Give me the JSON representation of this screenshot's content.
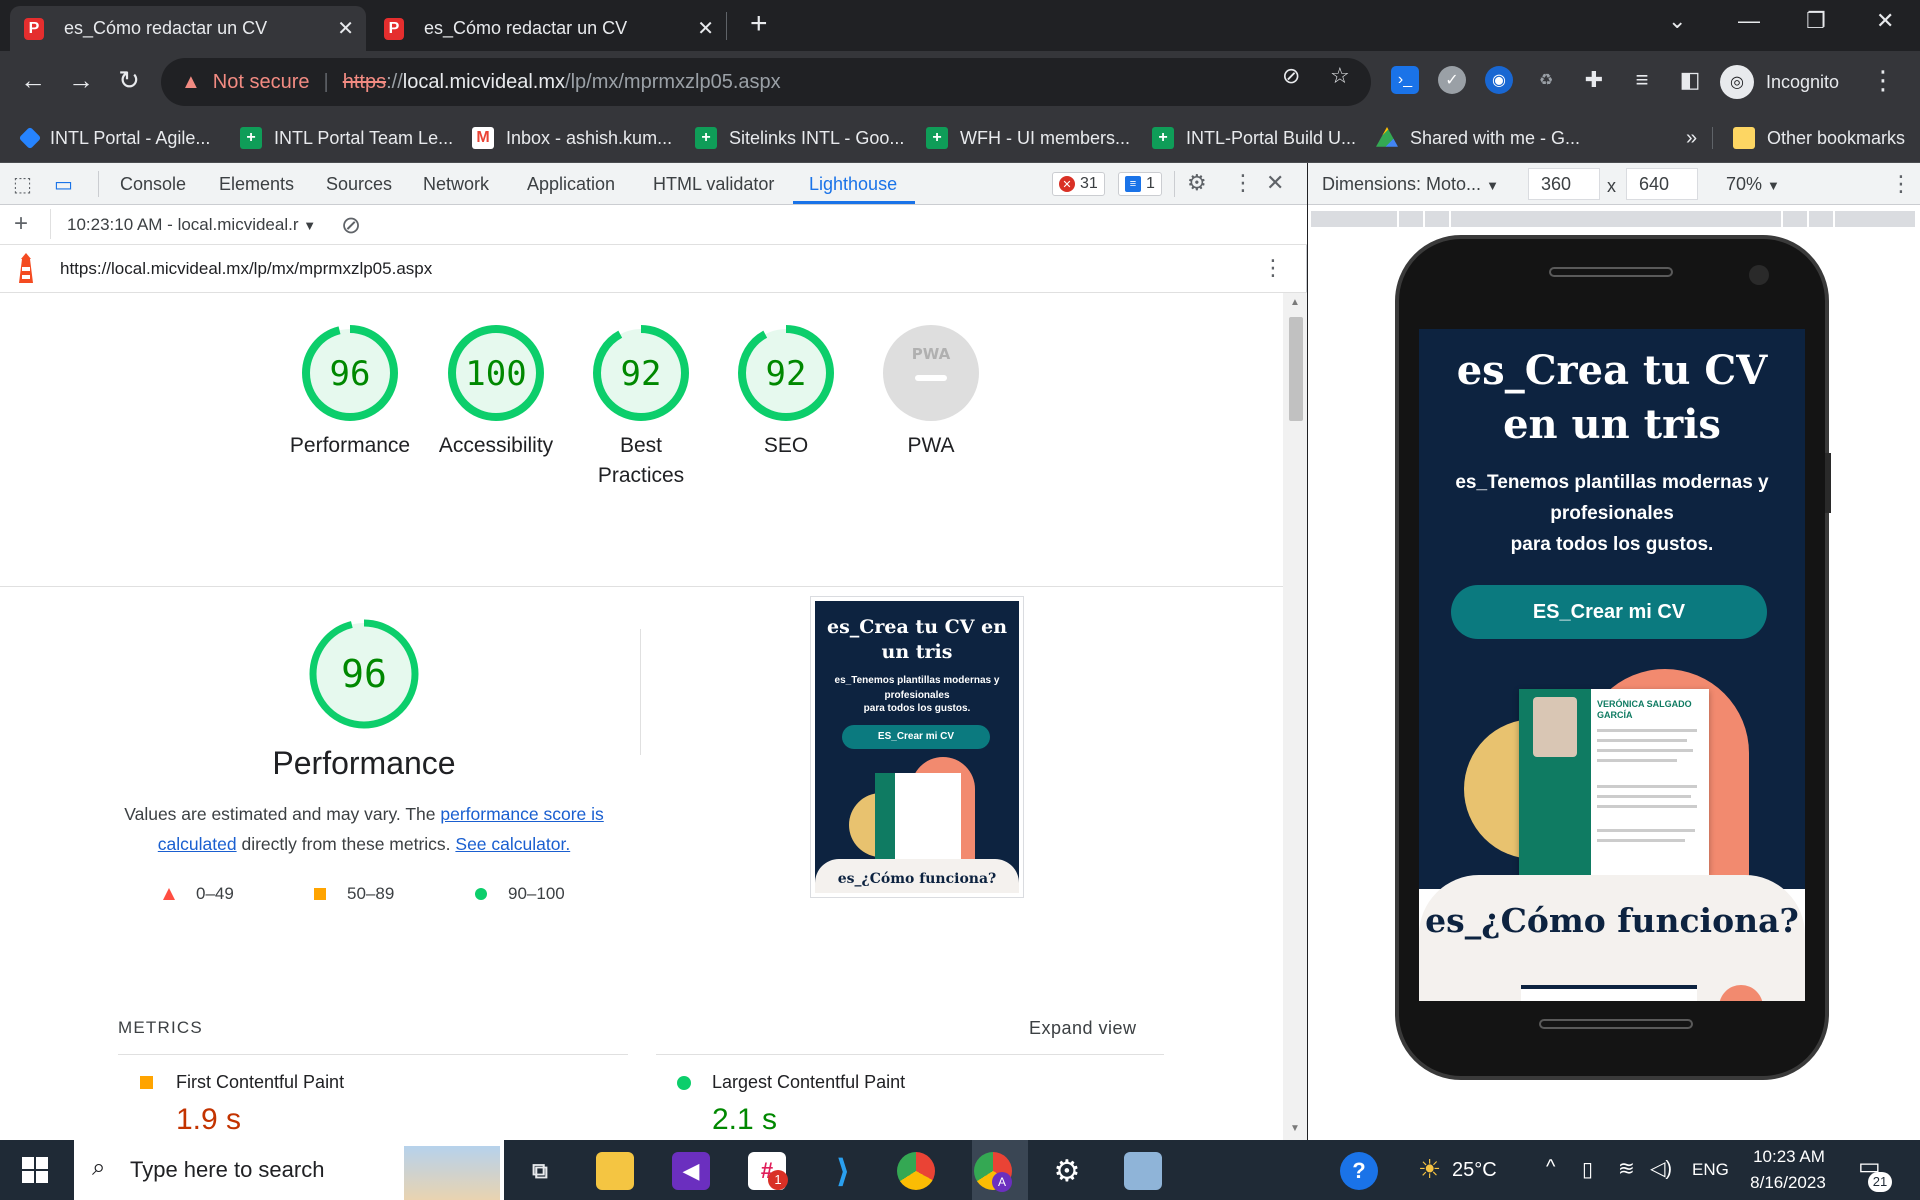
{
  "browser": {
    "tabs": [
      {
        "label": "es_Cómo redactar un CV",
        "active": true
      },
      {
        "label": "es_Cómo redactar un CV",
        "active": false
      }
    ],
    "omnibox": {
      "warning": "Not secure",
      "scheme": "https",
      "scheme_sep": "://",
      "host": "local.micvideal.mx",
      "path": "/lp/mx/mprmxzlp05.aspx"
    },
    "profile_label": "Incognito",
    "bookmarks": [
      {
        "label": "INTL Portal - Agile...",
        "icon": "jira-icon"
      },
      {
        "label": "INTL Portal Team Le...",
        "icon": "sheets-icon"
      },
      {
        "label": "Inbox - ashish.kum...",
        "icon": "gmail-icon"
      },
      {
        "label": "Sitelinks INTL - Goo...",
        "icon": "sheets-icon"
      },
      {
        "label": "WFH - UI members...",
        "icon": "sheets-icon"
      },
      {
        "label": "INTL-Portal Build U...",
        "icon": "sheets-icon"
      },
      {
        "label": "Shared with me - G...",
        "icon": "drive-icon"
      }
    ],
    "bookmarks_overflow": "»",
    "other_bookmarks": "Other bookmarks"
  },
  "devtools": {
    "tabs": [
      "Console",
      "Elements",
      "Sources",
      "Network",
      "Application",
      "HTML validator",
      "Lighthouse"
    ],
    "active_tab": "Lighthouse",
    "errors_count": "31",
    "messages_count": "1",
    "report_selector": "10:23:10 AM - local.micvideal.r",
    "report_url": "https://local.micvideal.mx/lp/mx/mprmxzlp05.aspx",
    "scores": [
      {
        "label": "Performance",
        "score": 96
      },
      {
        "label": "Accessibility",
        "score": 100
      },
      {
        "label": "Best Practices",
        "score": 92
      },
      {
        "label": "SEO",
        "score": 92
      },
      {
        "label": "PWA",
        "score": null
      }
    ],
    "pwa_badge": "PWA",
    "performance": {
      "score": "96",
      "title": "Performance",
      "desc_prefix": "Values are estimated and may vary. The ",
      "desc_link1": "performance score is calculated",
      "desc_mid": " directly from these metrics. ",
      "desc_link2": "See calculator.",
      "legend": [
        "0–49",
        "50–89",
        "90–100"
      ]
    },
    "metrics_header": "METRICS",
    "expand_view": "Expand view",
    "metrics": [
      {
        "name": "First Contentful Paint",
        "value": "1.9 s",
        "status": "average"
      },
      {
        "name": "Largest Contentful Paint",
        "value": "2.1 s",
        "status": "pass"
      }
    ],
    "thumbnail": {
      "hero_title": "es_Crea tu CV en un tris",
      "hero_sub1": "es_Tenemos plantillas modernas y profesionales",
      "hero_sub2": "para todos los gustos.",
      "cta": "ES_Crear mi CV",
      "next_section": "es_¿Cómo funciona?"
    }
  },
  "device_toolbar": {
    "device": "Dimensions: Moto...",
    "width": "360",
    "times": "x",
    "height": "640",
    "zoom": "70%"
  },
  "phone_screen": {
    "hero_title_line1": "es_Crea tu CV",
    "hero_title_line2": "en un tris",
    "hero_sub_line1": "es_Tenemos plantillas modernas y",
    "hero_sub_line2": "profesionales",
    "hero_sub_line3": "para todos los gustos.",
    "cta": "ES_Crear mi CV",
    "resume_name": "VERÓNICA SALGADO GARCÍA",
    "next_section": "es_¿Cómo funciona?"
  },
  "taskbar": {
    "search_placeholder": "Type here to search",
    "weather": "25°C",
    "language": "ENG",
    "time": "10:23 AM",
    "date": "8/16/2023",
    "notifications": "21",
    "slack_badge": "1",
    "chrome_profile_badge": "A"
  },
  "colors": {
    "pass": "#0cce6b",
    "pass_text": "#008800",
    "average": "#ffa400",
    "average_text": "#c33300",
    "fail": "#ff4e42",
    "hero_bg": "#0d2340",
    "cta_bg": "#0b7a7f"
  }
}
